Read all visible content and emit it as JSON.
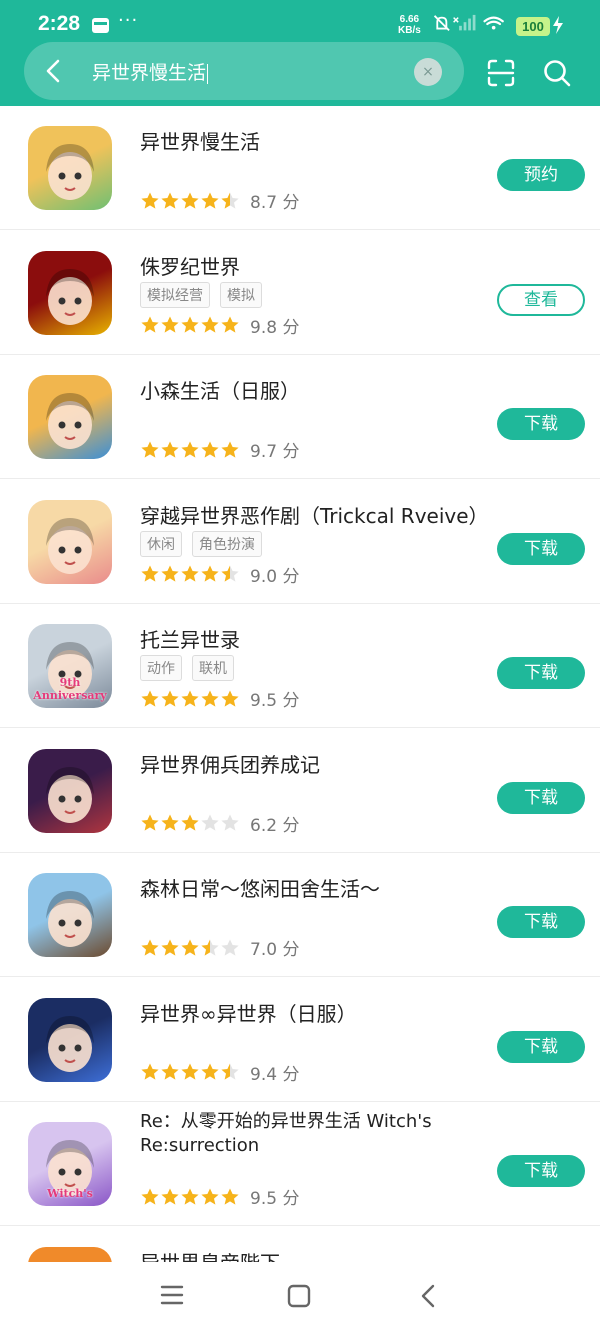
{
  "status_bar": {
    "time": "2:28",
    "dots": "···",
    "speed_top": "6.66",
    "speed_bottom": "KB/s",
    "battery": "100"
  },
  "search": {
    "query": "异世界慢生活",
    "clear_label": "×"
  },
  "colors": {
    "accent": "#1fb89a",
    "star": "#f6b31b",
    "star_empty": "#e3e3e3"
  },
  "apps": [
    {
      "name": "异世界慢生活",
      "tags": [],
      "stars": 4.5,
      "score": "8.7 分",
      "button": "预约",
      "style": "filled",
      "icon": [
        "#f0c25a",
        "#6fbf73"
      ]
    },
    {
      "name": "侏罗纪世界",
      "tags": [
        "模拟经营",
        "模拟"
      ],
      "stars": 5,
      "score": "9.8 分",
      "button": "查看",
      "style": "outline",
      "icon": [
        "#8b0d0d",
        "#e8b400"
      ]
    },
    {
      "name": "小森生活（日服）",
      "tags": [],
      "stars": 5,
      "score": "9.7 分",
      "button": "下载",
      "style": "filled",
      "icon": [
        "#f1b64e",
        "#3c8fd6"
      ]
    },
    {
      "name": "穿越异世界恶作剧（Trickcal Rveive）",
      "tags": [
        "休闲",
        "角色扮演"
      ],
      "stars": 4.5,
      "score": "9.0 分",
      "button": "下载",
      "style": "filled",
      "icon": [
        "#f7d9a6",
        "#e98b8b"
      ]
    },
    {
      "name": "托兰异世录",
      "tags": [
        "动作",
        "联机"
      ],
      "stars": 5,
      "score": "9.5 分",
      "button": "下载",
      "style": "filled",
      "icon": [
        "#c9d3dc",
        "#7c8a9a"
      ],
      "icon_text": "9th Anniversary"
    },
    {
      "name": "异世界佣兵团养成记",
      "tags": [],
      "stars": 3,
      "score": "6.2 分",
      "button": "下载",
      "style": "filled",
      "icon": [
        "#3a1c4a",
        "#b0353f"
      ]
    },
    {
      "name": "森林日常～悠闲田舍生活～",
      "tags": [],
      "stars": 3.5,
      "score": "7.0 分",
      "button": "下载",
      "style": "filled",
      "icon": [
        "#8fc4e8",
        "#6c4a2e"
      ]
    },
    {
      "name": "异世界∞异世界（日服）",
      "tags": [],
      "stars": 4.5,
      "score": "9.4 分",
      "button": "下载",
      "style": "filled",
      "icon": [
        "#1b2d63",
        "#3e6fd8"
      ]
    },
    {
      "name": "Re：从零开始的异世界生活 Witch's Re:surrection",
      "tags": [],
      "stars": 5,
      "score": "9.5 分",
      "button": "下载",
      "style": "filled",
      "icon": [
        "#d7c4ef",
        "#8a56c7"
      ],
      "icon_text": "Witch's"
    },
    {
      "name": "异世界皇帝陛下",
      "tags": [],
      "stars": 0,
      "score": "",
      "button": "",
      "style": "filled",
      "icon": [
        "#f08a2a",
        "#c2251a"
      ]
    }
  ]
}
